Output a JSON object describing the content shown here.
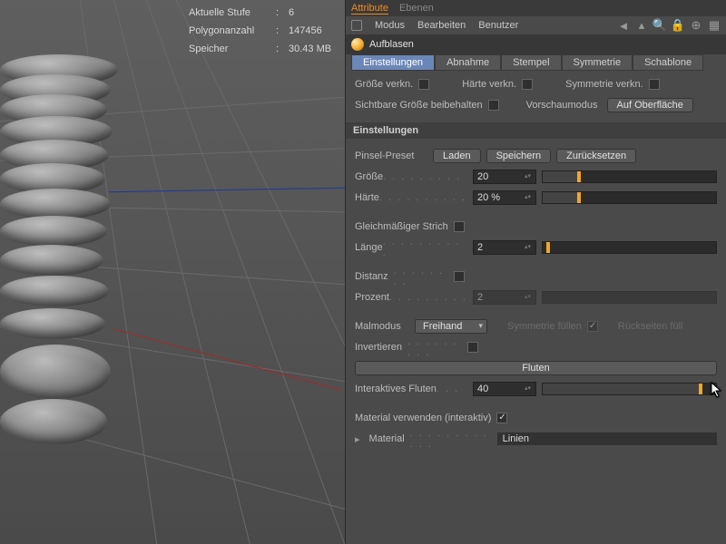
{
  "viewport": {
    "stats": {
      "stufe_label": "Aktuelle Stufe",
      "stufe_value": "6",
      "poly_label": "Polygonanzahl",
      "poly_value": "147456",
      "mem_label": "Speicher",
      "mem_value": "30.43 MB"
    }
  },
  "panel": {
    "tabs": {
      "attribute": "Attribute",
      "ebenen": "Ebenen"
    },
    "menus": {
      "modus": "Modus",
      "bearbeiten": "Bearbeiten",
      "benutzer": "Benutzer"
    },
    "tool_title": "Aufblasen",
    "subtabs": {
      "einstellungen": "Einstellungen",
      "abnahme": "Abnahme",
      "stempel": "Stempel",
      "symmetrie": "Symmetrie",
      "schablone": "Schablone"
    },
    "link_row": {
      "groesse": "Größe verkn.",
      "haerte": "Härte verkn.",
      "symmetrie": "Symmetrie verkn."
    },
    "visrow": {
      "sichtbar": "Sichtbare Größe beibehalten",
      "vorschau": "Vorschaumodus",
      "vorschau_value": "Auf Oberfläche"
    },
    "section_einstellungen": "Einstellungen",
    "preset": {
      "label": "Pinsel-Preset",
      "laden": "Laden",
      "speichern": "Speichern",
      "zuruecksetzen": "Zurücksetzen"
    },
    "groesse": {
      "label": "Größe",
      "value": "20",
      "pct": 20
    },
    "haerte": {
      "label": "Härte",
      "value": "20 %",
      "pct": 20
    },
    "gleich": "Gleichmäßiger Strich",
    "laenge": {
      "label": "Länge",
      "value": "2",
      "pct": 2
    },
    "distanz": "Distanz",
    "prozent": {
      "label": "Prozent",
      "value": "2",
      "pct": 2
    },
    "malmodus": {
      "label": "Malmodus",
      "value": "Freihand"
    },
    "symfill": "Symmetrie füllen",
    "rueckseiten": "Rückseiten füll",
    "invertieren": "Invertieren",
    "fluten_btn": "Fluten",
    "interaktiv": {
      "label": "Interaktives Fluten",
      "value": "40",
      "pct": 90
    },
    "material_use": "Material verwenden (interaktiv)",
    "material": {
      "label": "Material",
      "value": "Linien"
    }
  }
}
